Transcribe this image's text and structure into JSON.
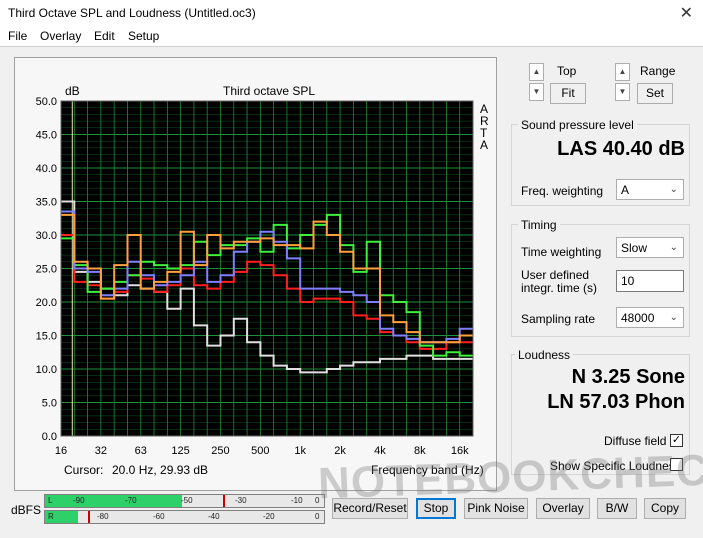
{
  "window": {
    "title": "Third Octave SPL and Loudness (Untitled.oc3)",
    "close_glyph": "✕"
  },
  "menu": [
    "File",
    "Overlay",
    "Edit",
    "Setup"
  ],
  "plot": {
    "title": "Third octave SPL",
    "y_unit": "dB",
    "side_label": [
      "A",
      "R",
      "T",
      "A"
    ],
    "cursor_label": "Cursor:",
    "cursor_value": "20.0 Hz, 29.93 dB",
    "x_label": "Frequency band (Hz)"
  },
  "chart_data": {
    "type": "line",
    "title": "Third octave SPL",
    "ylabel": "dB",
    "xlabel": "Frequency band (Hz)",
    "ylim": [
      0,
      50
    ],
    "ytick_step": 5,
    "grid": true,
    "background": "#000000",
    "grid_color": "#1e8f3a",
    "x_tick_labels": [
      "16",
      "32",
      "63",
      "125",
      "250",
      "500",
      "1k",
      "2k",
      "4k",
      "8k",
      "16k"
    ],
    "bands": [
      "16",
      "20",
      "25",
      "31.5",
      "40",
      "50",
      "63",
      "80",
      "100",
      "125",
      "160",
      "200",
      "250",
      "315",
      "400",
      "500",
      "630",
      "800",
      "1k",
      "1.25k",
      "1.6k",
      "2k",
      "2.5k",
      "3.15k",
      "4k",
      "5k",
      "6.3k",
      "8k",
      "10k",
      "12.5k",
      "16k"
    ],
    "series": [
      {
        "color": "#e0e0e0",
        "values": [
          35,
          24.5,
          23,
          22,
          21,
          22.5,
          22,
          21.5,
          19,
          22,
          16.5,
          13.5,
          15,
          17.5,
          14,
          12,
          10.5,
          10,
          9.5,
          9.5,
          10,
          10.5,
          11,
          11,
          11.5,
          11.5,
          12,
          12,
          11.5,
          11.5,
          11.5
        ]
      },
      {
        "color": "#ff2020",
        "values": [
          30,
          23,
          22.5,
          20.5,
          21.5,
          24,
          23.5,
          21.5,
          22.5,
          25,
          22.5,
          22,
          23,
          24.5,
          26,
          25.5,
          24,
          22,
          20,
          20.5,
          20.5,
          20,
          18,
          17.5,
          15.5,
          15,
          14,
          13,
          13,
          14,
          14
        ]
      },
      {
        "color": "#3cf03c",
        "values": [
          29.5,
          25.5,
          21.5,
          22,
          23,
          24,
          26,
          25.5,
          25,
          25.5,
          29,
          27,
          28.5,
          28.5,
          29.5,
          27.5,
          31.5,
          28,
          30,
          31.5,
          33,
          28.5,
          24.5,
          29,
          21,
          20,
          18.5,
          13.5,
          12,
          12.5,
          12
        ]
      },
      {
        "color": "#8080ff",
        "values": [
          33.5,
          25,
          24.5,
          21,
          22,
          26,
          24,
          22.5,
          23,
          24,
          26,
          23,
          24,
          27.5,
          29,
          30.5,
          29,
          26.5,
          22,
          22,
          22,
          21.5,
          21,
          20,
          16,
          15,
          14.5,
          14,
          14,
          14.5,
          16
        ]
      },
      {
        "color": "#ffa040",
        "values": [
          33,
          26,
          25,
          20.5,
          25.5,
          30,
          22,
          23,
          24.5,
          30.5,
          25.5,
          30,
          28,
          29,
          29,
          29.5,
          28.5,
          28.5,
          28,
          32,
          30,
          27.5,
          25,
          25,
          18,
          17,
          15.5,
          14,
          14,
          14,
          15
        ]
      }
    ]
  },
  "controls": {
    "top_label": "Top",
    "range_label": "Range",
    "fit_label": "Fit",
    "set_label": "Set",
    "up_glyph": "▲",
    "down_glyph": "▼"
  },
  "spl": {
    "group_title": "Sound pressure level",
    "value": "LAS 40.40 dB",
    "freq_weighting_label": "Freq. weighting",
    "freq_weighting_value": "A"
  },
  "timing": {
    "group_title": "Timing",
    "time_weighting_label": "Time weighting",
    "time_weighting_value": "Slow",
    "user_defined_label_1": "User defined",
    "user_defined_label_2": "integr. time (s)",
    "integration_time": "10",
    "sampling_rate_label": "Sampling rate",
    "sampling_rate_value": "48000"
  },
  "loudness": {
    "group_title": "Loudness",
    "sone": "N 3.25 Sone",
    "phon": "LN 57.03 Phon",
    "diffuse_field_label": "Diffuse field",
    "diffuse_field_checked": "✓",
    "show_specific_label": "Show Specific Loudness"
  },
  "meter": {
    "label": "dBFS",
    "channel_l": "L",
    "channel_r": "R",
    "scale_top": [
      "-90",
      "-70",
      "-50",
      "-30",
      "-10",
      "0"
    ],
    "scale_bottom": [
      "-80",
      "-60",
      "-40",
      "-20",
      "0"
    ],
    "level_l": 0.49,
    "level_r": 0.12
  },
  "buttons": {
    "record_reset": "Record/Reset",
    "stop": "Stop",
    "pink_noise": "Pink Noise",
    "overlay": "Overlay",
    "bw": "B/W",
    "copy": "Copy"
  },
  "watermark": "NOTEBOOKCHECK"
}
